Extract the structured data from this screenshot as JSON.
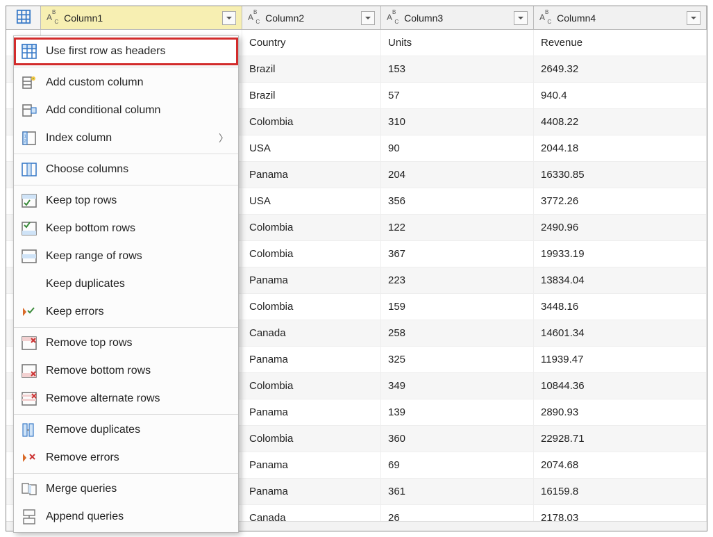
{
  "columns": [
    {
      "name": "Column1",
      "type": "ABC"
    },
    {
      "name": "Column2",
      "type": "ABC"
    },
    {
      "name": "Column3",
      "type": "ABC"
    },
    {
      "name": "Column4",
      "type": "ABC"
    }
  ],
  "rows": [
    {
      "c2": "Country",
      "c3": "Units",
      "c4": "Revenue"
    },
    {
      "c2": "Brazil",
      "c3": "153",
      "c4": "2649.32"
    },
    {
      "c2": "Brazil",
      "c3": "57",
      "c4": "940.4"
    },
    {
      "c2": "Colombia",
      "c3": "310",
      "c4": "4408.22"
    },
    {
      "c2": "USA",
      "c3": "90",
      "c4": "2044.18"
    },
    {
      "c2": "Panama",
      "c3": "204",
      "c4": "16330.85"
    },
    {
      "c2": "USA",
      "c3": "356",
      "c4": "3772.26"
    },
    {
      "c2": "Colombia",
      "c3": "122",
      "c4": "2490.96"
    },
    {
      "c2": "Colombia",
      "c3": "367",
      "c4": "19933.19"
    },
    {
      "c2": "Panama",
      "c3": "223",
      "c4": "13834.04"
    },
    {
      "c2": "Colombia",
      "c3": "159",
      "c4": "3448.16"
    },
    {
      "c2": "Canada",
      "c3": "258",
      "c4": "14601.34"
    },
    {
      "c2": "Panama",
      "c3": "325",
      "c4": "11939.47"
    },
    {
      "c2": "Colombia",
      "c3": "349",
      "c4": "10844.36"
    },
    {
      "c2": "Panama",
      "c3": "139",
      "c4": "2890.93"
    },
    {
      "c2": "Colombia",
      "c3": "360",
      "c4": "22928.71"
    },
    {
      "c2": "Panama",
      "c3": "69",
      "c4": "2074.68"
    },
    {
      "c2": "Panama",
      "c3": "361",
      "c4": "16159.8"
    },
    {
      "c2": "Canada",
      "c3": "26",
      "c4": "2178.03"
    }
  ],
  "menu": {
    "use_first_row": "Use first row as headers",
    "add_custom_column": "Add custom column",
    "add_conditional_column": "Add conditional column",
    "index_column": "Index column",
    "choose_columns": "Choose columns",
    "keep_top_rows": "Keep top rows",
    "keep_bottom_rows": "Keep bottom rows",
    "keep_range_rows": "Keep range of rows",
    "keep_duplicates": "Keep duplicates",
    "keep_errors": "Keep errors",
    "remove_top_rows": "Remove top rows",
    "remove_bottom_rows": "Remove bottom rows",
    "remove_alternate_rows": "Remove alternate rows",
    "remove_duplicates": "Remove duplicates",
    "remove_errors": "Remove errors",
    "merge_queries": "Merge queries",
    "append_queries": "Append queries"
  }
}
